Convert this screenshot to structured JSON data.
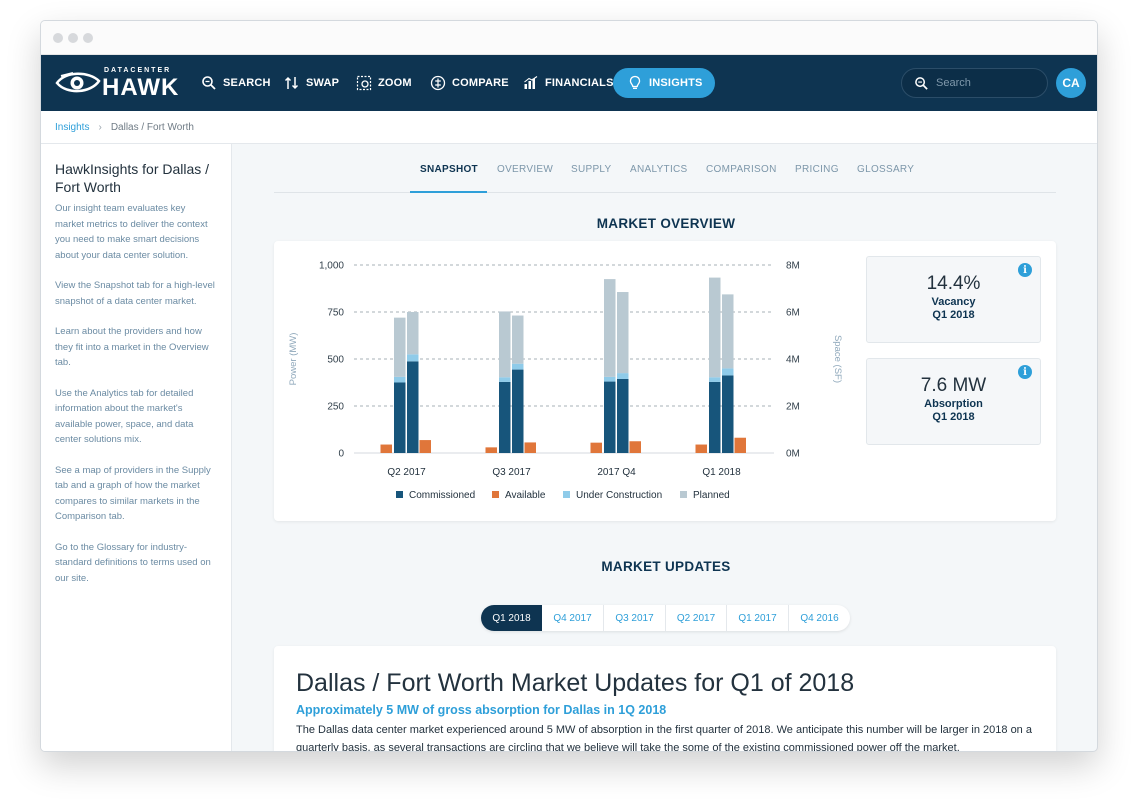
{
  "brand": {
    "small": "DATACENTER",
    "big": "HAWK"
  },
  "nav": [
    {
      "label": "SEARCH",
      "icon": "search-icon"
    },
    {
      "label": "SWAP",
      "icon": "swap-icon"
    },
    {
      "label": "ZOOM",
      "icon": "zoom-icon"
    },
    {
      "label": "COMPARE",
      "icon": "compare-icon"
    },
    {
      "label": "FINANCIALS",
      "icon": "financials-icon"
    },
    {
      "label": "INSIGHTS",
      "icon": "lightbulb-icon",
      "active": true
    }
  ],
  "search": {
    "placeholder": "Search"
  },
  "user": {
    "initials": "CA"
  },
  "breadcrumb": {
    "root": "Insights",
    "current": "Dallas / Fort Worth"
  },
  "sidebar": {
    "title": "HawkInsights for Dallas / Fort Worth",
    "paragraphs": [
      "Our insight team evaluates key market metrics to deliver the context you need to make smart decisions about your data center solution.",
      "View the Snapshot tab for a high-level snapshot of a data center market.",
      "Learn about the providers and how they fit into a market in the Overview tab.",
      "Use the Analytics tab for detailed information about the market's available power, space, and data center solutions mix.",
      "See a map of providers in the Supply tab and a graph of how the market compares to similar markets in the Comparison tab.",
      "Go to the Glossary for industry-standard definitions to terms used on our site."
    ]
  },
  "tabs": [
    "SNAPSHOT",
    "OVERVIEW",
    "SUPPLY",
    "ANALYTICS",
    "COMPARISON",
    "PRICING",
    "GLOSSARY"
  ],
  "market_overview": {
    "title": "MARKET OVERVIEW",
    "stats": [
      {
        "value": "14.4%",
        "label": "Vacancy",
        "period": "Q1 2018"
      },
      {
        "value": "7.6 MW",
        "label": "Absorption",
        "period": "Q1 2018"
      }
    ]
  },
  "chart_data": {
    "type": "bar",
    "stacked": true,
    "categories": [
      "Q2 2017",
      "Q3 2017",
      "2017 Q4",
      "Q1 2018"
    ],
    "ylabel": "Power (MW)",
    "y2label": "Space (SF)",
    "ylim": [
      0,
      1000
    ],
    "yticks": [
      "0",
      "250",
      "500",
      "750",
      "1,000"
    ],
    "y2ticks": [
      "0M",
      "2M",
      "4M",
      "6M",
      "8M"
    ],
    "grid": true,
    "legend_position": "bottom",
    "colors": {
      "Commissioned": "#17557b",
      "Available": "#e0763a",
      "Under Construction": "#8fcbe9",
      "Planned": "#b9c9d2"
    },
    "series": [
      {
        "name": "Commissioned",
        "axis": "power",
        "values": [
          375,
          378,
          380,
          378
        ]
      },
      {
        "name": "Under Construction",
        "axis": "power",
        "values": [
          30,
          25,
          25,
          25
        ]
      },
      {
        "name": "Planned",
        "axis": "power",
        "values": [
          315,
          350,
          520,
          530
        ]
      },
      {
        "name": "Commissioned",
        "axis": "space",
        "values": [
          3.9,
          3.55,
          3.15,
          3.3
        ]
      },
      {
        "name": "Under Construction",
        "axis": "space",
        "values": [
          0.3,
          0.25,
          0.25,
          0.3
        ]
      },
      {
        "name": "Planned",
        "axis": "space",
        "values": [
          1.8,
          2.05,
          3.45,
          3.15
        ]
      },
      {
        "name": "Available",
        "axis": "power",
        "values": [
          45,
          30,
          55,
          45
        ]
      },
      {
        "name": "Available",
        "axis": "space",
        "values": [
          0.55,
          0.45,
          0.5,
          0.65
        ]
      }
    ]
  },
  "market_updates": {
    "title": "MARKET UPDATES",
    "periods": [
      "Q1 2018",
      "Q4 2017",
      "Q3 2017",
      "Q2 2017",
      "Q1 2017",
      "Q4 2016"
    ],
    "active_period": "Q1 2018",
    "heading": "Dallas / Fort Worth Market Updates for Q1 of 2018",
    "subheading": "Approximately 5 MW of gross absorption for Dallas in 1Q 2018",
    "body": "The Dallas data center market experienced around 5 MW of absorption in the first quarter of 2018. We anticipate this number will be larger in 2018 on a quarterly basis, as several transactions are circling that we believe will take the some of the existing commissioned power off the market."
  }
}
